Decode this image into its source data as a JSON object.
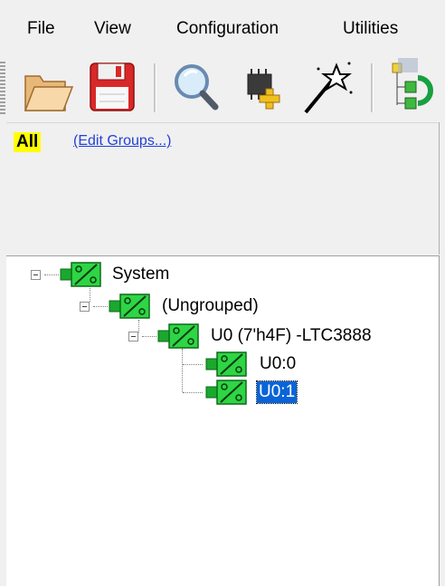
{
  "menu": {
    "file": "File",
    "view": "View",
    "configuration": "Configuration",
    "utilities": "Utilities"
  },
  "toolbar": {
    "buttons": [
      "open-folder-icon",
      "save-icon",
      "search-icon",
      "add-device-icon",
      "magic-wand-icon",
      "tree-refresh-icon"
    ]
  },
  "groups": {
    "all_label": "All",
    "edit_link": "(Edit Groups...)"
  },
  "tree": {
    "system": "System",
    "ungrouped": "(Ungrouped)",
    "device": "U0 (7'h4F) -LTC3888",
    "rail0": "U0:0",
    "rail1": "U0:1"
  },
  "colors": {
    "selection": "#0a64d8",
    "device_green": "#22c93a",
    "highlight_yellow": "#ffff00",
    "link_blue": "#2340d8"
  }
}
